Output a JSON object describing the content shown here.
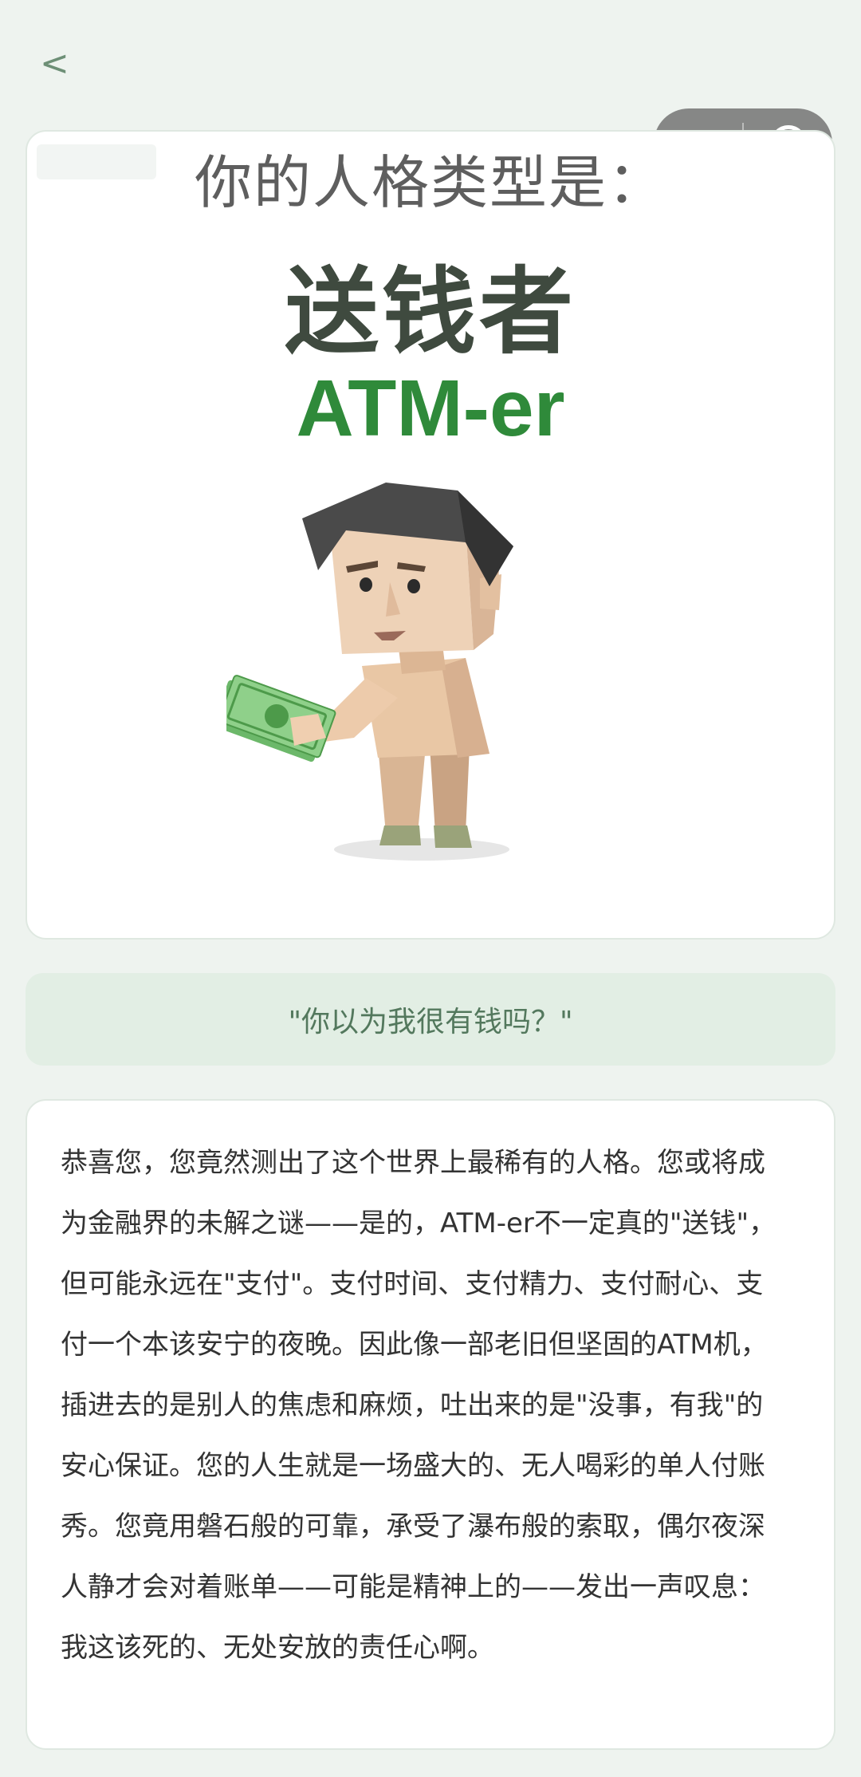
{
  "nav": {
    "back_label": "<"
  },
  "capsule": {
    "more_icon": "more-dots-icon",
    "close_icon": "target-close-icon"
  },
  "result": {
    "heading": "你的人格类型是：",
    "type_cn": "送钱者",
    "type_en": "ATM-er",
    "illustration": "person-holding-money",
    "accent_color": "#2f8a3a"
  },
  "quote": "\"你以为我很有钱吗？\"",
  "description": "恭喜您，您竟然测出了这个世界上最稀有的人格。您或将成为金融界的未解之谜——是的，ATM-er不一定真的\"送钱\"，但可能永远在\"支付\"。支付时间、支付精力、支付耐心、支付一个本该安宁的夜晚。因此像一部老旧但坚固的ATM机，插进去的是别人的焦虑和麻烦，吐出来的是\"没事，有我\"的安心保证。您的人生就是一场盛大的、无人喝彩的单人付账秀。您竟用磐石般的可靠，承受了瀑布般的索取，偶尔夜深人静才会对着账单——可能是精神上的——发出一声叹息：我这该死的、无处安放的责任心啊。"
}
